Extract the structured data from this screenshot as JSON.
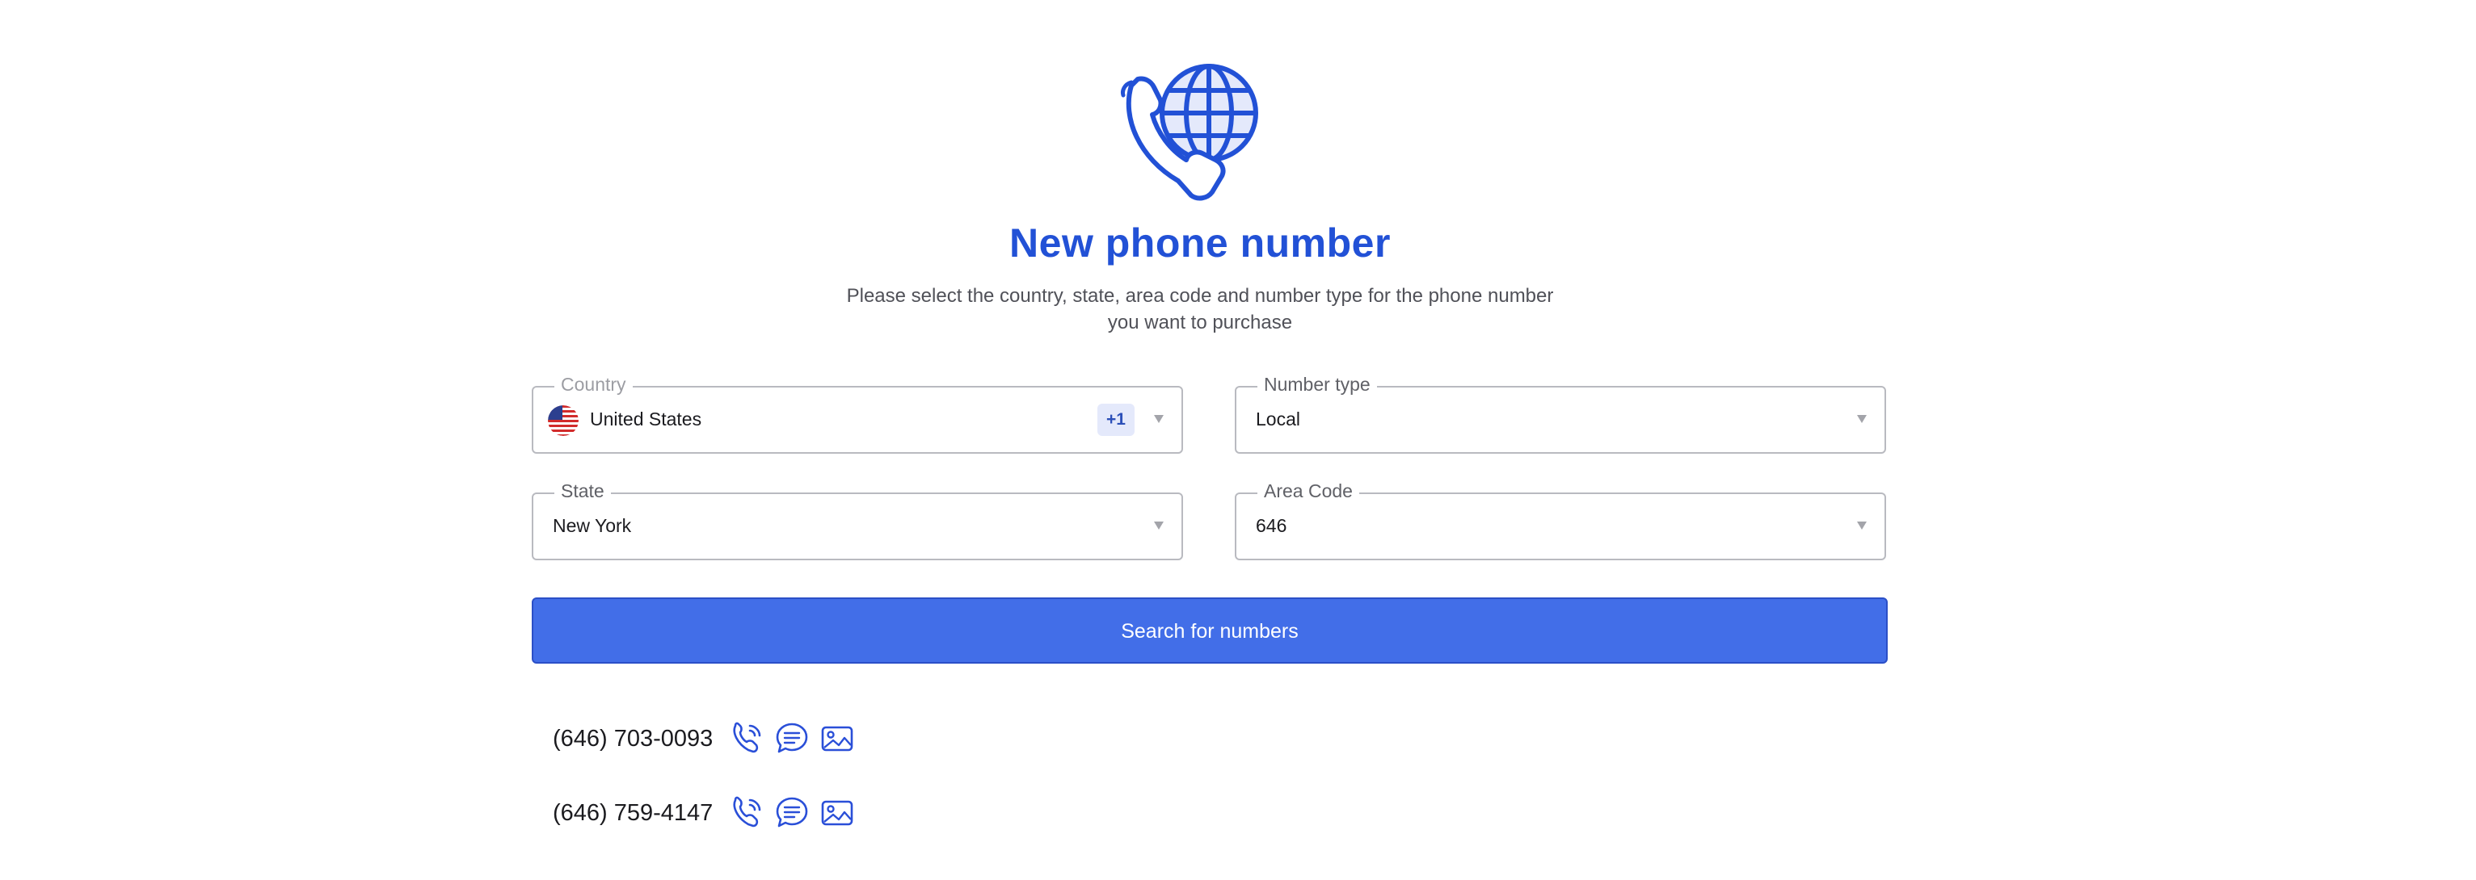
{
  "header": {
    "title": "New phone number",
    "subtitle": "Please select the country, state, area code and number type for the phone number you want to purchase",
    "icon": "globe-phone-icon"
  },
  "form": {
    "country": {
      "label": "Country",
      "value": "United States",
      "dial_code": "+1",
      "flag_icon": "us-flag-icon"
    },
    "number_type": {
      "label": "Number type",
      "value": "Local"
    },
    "state": {
      "label": "State",
      "value": "New York"
    },
    "area_code": {
      "label": "Area Code",
      "value": "646"
    },
    "search_button_label": "Search for numbers"
  },
  "results": [
    {
      "number": "(646) 703-0093",
      "capabilities": [
        "voice-icon",
        "sms-icon",
        "mms-icon"
      ]
    },
    {
      "number": "(646) 759-4147",
      "capabilities": [
        "voice-icon",
        "sms-icon",
        "mms-icon"
      ]
    }
  ],
  "colors": {
    "accent": "#2251d6",
    "button": "#426ee8",
    "icon_blue": "#2a4fd8"
  }
}
